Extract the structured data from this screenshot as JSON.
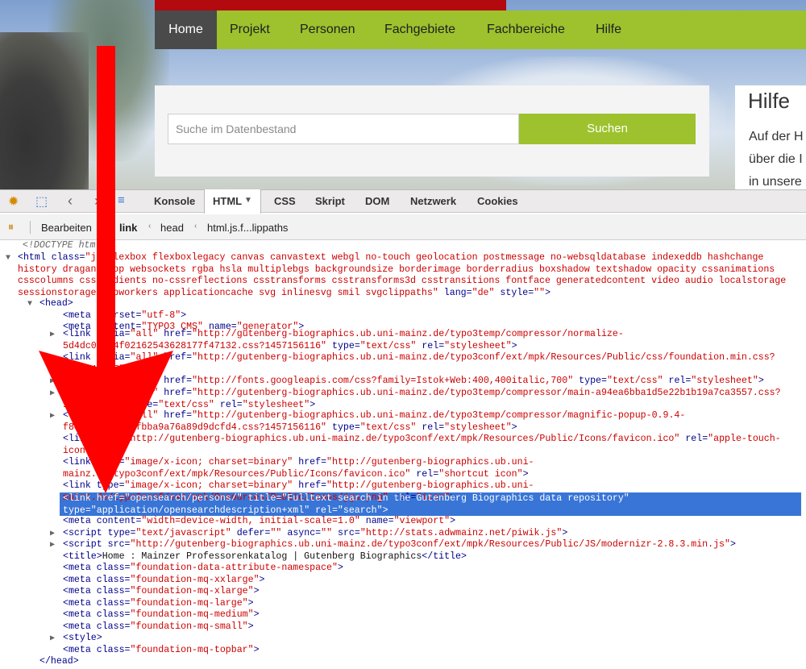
{
  "site": {
    "nav": [
      "Home",
      "Projekt",
      "Personen",
      "Fachgebiete",
      "Fachbereiche",
      "Hilfe"
    ],
    "search": {
      "placeholder": "Suche im Datenbestand",
      "button": "Suchen"
    },
    "help": {
      "title": "Hilfe",
      "lines": [
        "Auf der H",
        "über die I",
        "in unsere"
      ]
    }
  },
  "firebug": {
    "tabs": [
      "Konsole",
      "HTML",
      "CSS",
      "Skript",
      "DOM",
      "Netzwerk",
      "Cookies"
    ],
    "active_tab": "HTML",
    "toolbar": {
      "edit": "Bearbeiten",
      "crumbs": [
        "link",
        "head",
        "html.js.f...lippaths"
      ]
    }
  },
  "tree": {
    "doctype": "<!DOCTYPE html>",
    "html_class": "js flexbox flexboxlegacy canvas canvastext webgl no-touch geolocation postmessage no-websqldatabase indexeddb hashchange history draganddrop websockets rgba hsla multiplebgs backgroundsize borderimage borderradius boxshadow textshadow opacity cssanimations csscolumns cssgradients no-cssreflections csstransforms csstransforms3d csstransitions fontface generatedcontent video audio localstorage sessionstorage webworkers applicationcache svg inlinesvg smil svgclippaths",
    "html_lang": "de",
    "meta_charset": "utf-8",
    "meta_generator": "TYPO3 CMS",
    "link1_href": "http://gutenberg-biographics.ub.uni-mainz.de/typo3temp/compressor/normalize-5d4dc0a174f02162543628177f47132.css?1457156116",
    "link2_href": "http://gutenberg-biographics.ub.uni-mainz.de/typo3conf/ext/mpk/Resources/Public/css/foundation.min.css?1417441605",
    "link3_href": "http://fonts.googleapis.com/css?family=Istok+Web:400,400italic,700",
    "link4_href": "http://gutenberg-biographics.ub.uni-mainz.de/typo3temp/compressor/main-a94ea6bba1d5e22b1b19a7ca3557.css?1468239441",
    "link5_href": "http://gutenberg-biographics.ub.uni-mainz.de/typo3temp/compressor/magnific-popup-0.9.4-f8ebeba16da37fbba9a76a89d9dcfd4.css?1457156116",
    "icon1_href": "http://gutenberg-biographics.ub.uni-mainz.de/typo3conf/ext/mpk/Resources/Public/Icons/favicon.ico",
    "icon2_href": "http://gutenberg-biographics.ub.uni-mainz.de/typo3conf/ext/mpk/Resources/Public/Icons/favicon.ico",
    "icon3_href": "http://gutenberg-biographics.ub.uni-mainz.de/typo3conf/ext/mpk/Resources/Public/Icons/jgu.png",
    "search_link_href": "opensearch/persons/",
    "search_link_title": "Fulltext search in the Gutenberg Biographics data repository",
    "search_link_type": "application/opensearchdescription+xml",
    "viewport": "width=device-width, initial-scale=1.0",
    "piwik_src": "http://stats.adwmainz.net/piwik.js",
    "modernizr_src": "http://gutenberg-biographics.ub.uni-mainz.de/typo3conf/ext/mpk/Resources/Public/JS/modernizr-2.8.3.min.js",
    "title": "Home : Mainzer Professorenkatalog | Gutenberg Biographics",
    "meta_classes": [
      "foundation-data-attribute-namespace",
      "foundation-mq-xxlarge",
      "foundation-mq-xlarge",
      "foundation-mq-large",
      "foundation-mq-medium",
      "foundation-mq-small"
    ],
    "meta_topbar": "foundation-mq-topbar"
  },
  "colors": {
    "nav_green": "#9dc22d",
    "brand_red": "#b30a10",
    "selection_blue": "#3875d7",
    "arrow_red": "#ff0000"
  }
}
